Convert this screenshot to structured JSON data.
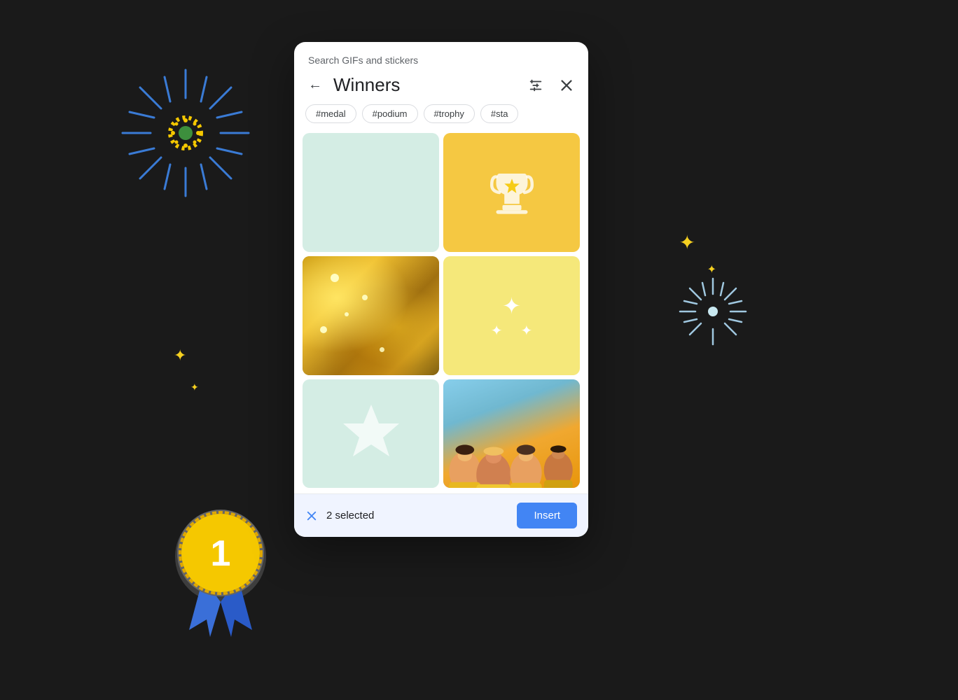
{
  "background": "#1a1a1a",
  "dialog": {
    "header_label": "Search GIFs and stickers",
    "title": "Winners",
    "back_label": "←",
    "close_label": "×",
    "filter_label": "⚙"
  },
  "tags": [
    "#medal",
    "#podium",
    "#trophy",
    "#sta"
  ],
  "grid": {
    "cells": [
      {
        "id": 1,
        "type": "plain-green",
        "alt": "green background gif"
      },
      {
        "id": 2,
        "type": "trophy",
        "alt": "trophy icon gif"
      },
      {
        "id": 3,
        "type": "glitter",
        "alt": "gold glitter gif"
      },
      {
        "id": 4,
        "type": "sparkles",
        "alt": "sparkle stars gif"
      },
      {
        "id": 5,
        "type": "star",
        "alt": "star on green gif"
      },
      {
        "id": 6,
        "type": "people",
        "alt": "celebrating people gif"
      }
    ]
  },
  "bottom_bar": {
    "selected_count": "2 selected",
    "insert_label": "Insert",
    "clear_label": "×"
  }
}
